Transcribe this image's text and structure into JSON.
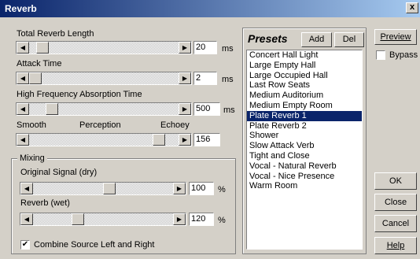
{
  "window": {
    "title": "Reverb",
    "close_glyph": "x"
  },
  "controls": {
    "total_reverb_length": {
      "label": "Total Reverb Length",
      "value": "20",
      "unit": "ms",
      "level": 0.05
    },
    "attack_time": {
      "label": "Attack Time",
      "value": "2",
      "unit": "ms",
      "level": 0.0
    },
    "hf_absorption": {
      "label": "High Frequency Absorption Time",
      "value": "500",
      "unit": "ms",
      "level": 0.12
    },
    "perception": {
      "label_left": "Smooth",
      "label_mid": "Perception",
      "label_right": "Echoey",
      "value": "156",
      "level": 0.9
    }
  },
  "mixing": {
    "group_label": "Mixing",
    "original": {
      "label": "Original Signal (dry)",
      "value": "100",
      "unit": "%",
      "level": 0.55
    },
    "reverb": {
      "label": "Reverb (wet)",
      "value": "120",
      "unit": "%",
      "level": 0.3
    },
    "combine": {
      "label": "Combine Source Left and Right",
      "checked": true
    }
  },
  "presets": {
    "title": "Presets",
    "add_label": "Add",
    "del_label": "Del",
    "items": [
      "Concert Hall Light",
      "Large Empty Hall",
      "Large Occupied Hall",
      "Last Row Seats",
      "Medium Auditorium",
      "Medium Empty Room",
      "Plate Reverb 1",
      "Plate Reverb 2",
      "Shower",
      "Slow Attack Verb",
      "Tight and Close",
      "Vocal - Natural Reverb",
      "Vocal - Nice Presence",
      "Warm Room"
    ],
    "selected_index": 6
  },
  "side": {
    "preview_label": "Preview",
    "bypass_label": "Bypass",
    "ok_label": "OK",
    "close_label": "Close",
    "cancel_label": "Cancel",
    "help_label": "Help"
  },
  "icons": {
    "left_arrow": "◀",
    "right_arrow": "▶",
    "check": "✔"
  }
}
